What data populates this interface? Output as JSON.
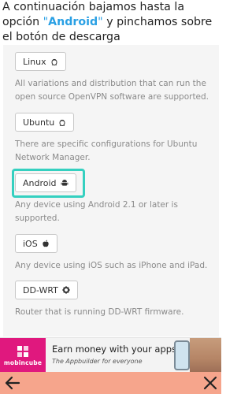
{
  "header": {
    "text_before": "A continuación bajamos hasta la opción ",
    "quote_open": "\"",
    "highlight": "Android",
    "quote_close": "\"",
    "text_after": " y pinchamos sobre el botón de descarga"
  },
  "platforms": [
    {
      "label": "Linux",
      "icon": "linux-tux-icon",
      "description": "All variations and distribution that can run the open source OpenVPN software are supported."
    },
    {
      "label": "Ubuntu",
      "icon": "linux-tux-icon",
      "description": "There are specific configurations for Ubuntu Network Manager."
    },
    {
      "label": "Android",
      "icon": "android-icon",
      "description": "Any device using Android 2.1 or later is supported."
    },
    {
      "label": "iOS",
      "icon": "apple-icon",
      "description": "Any device using iOS such as iPhone and iPad."
    },
    {
      "label": "DD-WRT",
      "icon": "gear-icon",
      "description": "Router that is running DD-WRT firmware."
    }
  ],
  "ad": {
    "brand": "mobincube",
    "title": "Earn money with your apps",
    "subtitle": "The Appbuilder for everyone"
  },
  "colors": {
    "accent": "#2aa0e4",
    "highlight_box": "#35d0c0",
    "bottom_bar": "#f6a58c",
    "ad_brand": "#e0187e"
  },
  "nav": {
    "back_icon": "arrow-left-icon",
    "close_icon": "close-icon"
  }
}
